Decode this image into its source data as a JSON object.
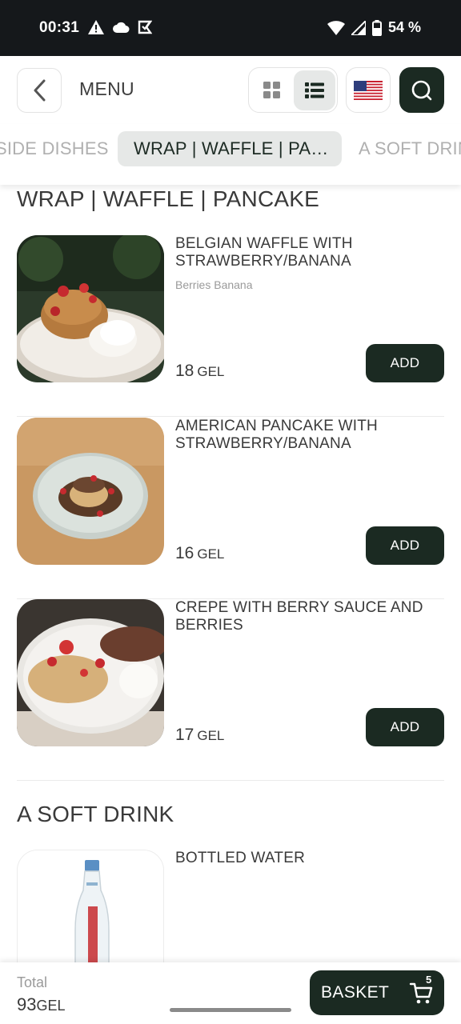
{
  "status": {
    "time": "00:31",
    "battery": "54 %"
  },
  "header": {
    "title": "MENU"
  },
  "categories": [
    {
      "label": "SIDE DISHES"
    },
    {
      "label": "WRAP | WAFFLE | PAN..."
    },
    {
      "label": "A SOFT DRINK"
    }
  ],
  "sections": [
    {
      "title": "WRAP | WAFFLE | PANCAKE",
      "items": [
        {
          "name": "BELGIAN WAFFLE WITH STRAWBERRY/BANANA",
          "desc": "Berries Banana",
          "price": "18",
          "currency": "GEL",
          "add_label": "ADD"
        },
        {
          "name": "AMERICAN PANCAKE WITH STRAWBERRY/BANANA",
          "desc": "",
          "price": "16",
          "currency": "GEL",
          "add_label": "ADD"
        },
        {
          "name": "CREPE WITH BERRY SAUCE AND BERRIES",
          "desc": "",
          "price": "17",
          "currency": "GEL",
          "add_label": "ADD"
        }
      ]
    },
    {
      "title": "A SOFT DRINK",
      "items": [
        {
          "name": "BOTTLED WATER"
        }
      ]
    }
  ],
  "footer": {
    "total_label": "Total",
    "total_value": "93",
    "total_currency": "GEL",
    "basket_label": "BASKET",
    "basket_count": "5"
  },
  "colors": {
    "accent": "#1b2a22",
    "status_bar": "#15181b",
    "chip_active": "#e6e8e7"
  }
}
